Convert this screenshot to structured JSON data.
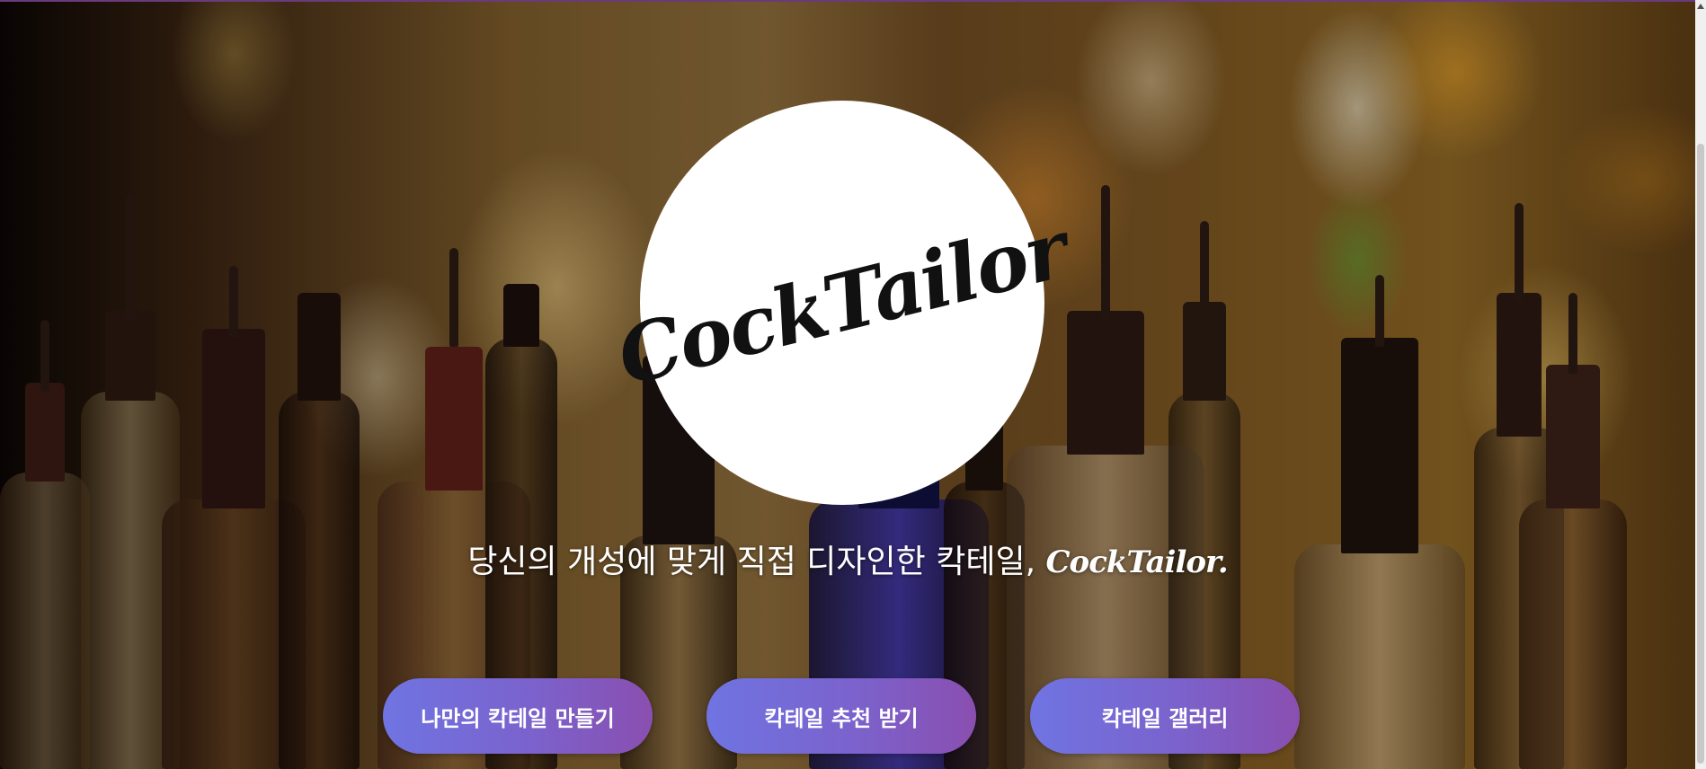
{
  "hero": {
    "logo_text": "CockTailor",
    "tagline": "당신의 개성에 맞게 직접 디자인한 칵테일,",
    "tagline_brand": "CockTailor."
  },
  "buttons": {
    "make": "나만의 칵테일 만들기",
    "recommend": "칵테일 추천 받기",
    "gallery": "칵테일 갤러리"
  },
  "colors": {
    "button_gradient_start": "#6f74e2",
    "button_gradient_end": "#8a4fb0",
    "logo_bg": "#ffffff"
  },
  "icons": {
    "scroll_up": "triangle-up-icon"
  }
}
